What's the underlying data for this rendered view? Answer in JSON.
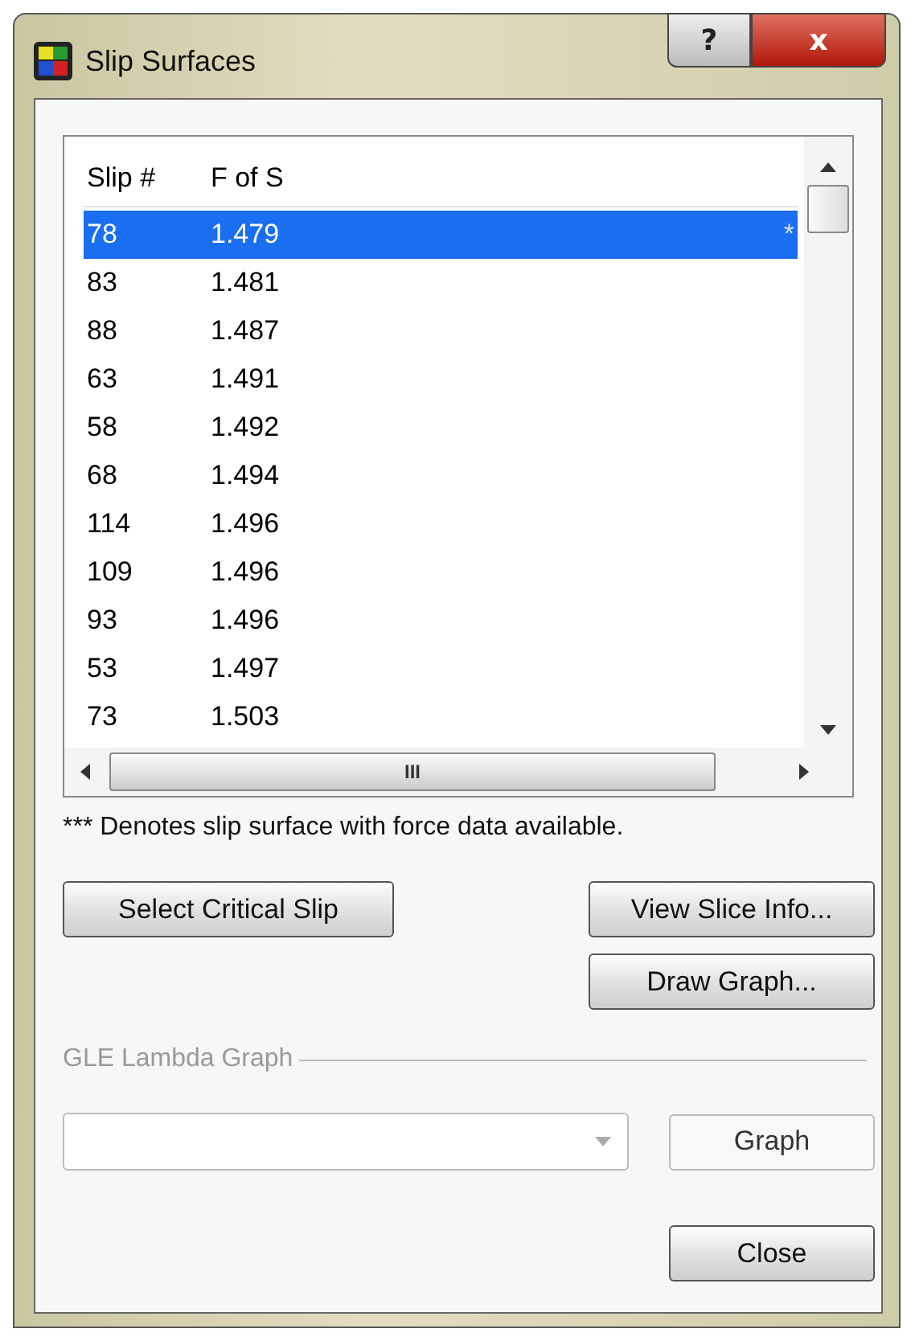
{
  "window": {
    "title": "Slip Surfaces",
    "help": "?",
    "close": "x"
  },
  "list": {
    "columns": [
      "Slip #",
      "F of S"
    ],
    "rows": [
      {
        "slip": "78",
        "fos": "1.479",
        "flag": "*",
        "selected": true
      },
      {
        "slip": "83",
        "fos": "1.481",
        "selected": false
      },
      {
        "slip": "88",
        "fos": "1.487",
        "selected": false
      },
      {
        "slip": "63",
        "fos": "1.491",
        "selected": false
      },
      {
        "slip": "58",
        "fos": "1.492",
        "selected": false
      },
      {
        "slip": "68",
        "fos": "1.494",
        "selected": false
      },
      {
        "slip": "114",
        "fos": "1.496",
        "selected": false
      },
      {
        "slip": "109",
        "fos": "1.496",
        "selected": false
      },
      {
        "slip": "93",
        "fos": "1.496",
        "selected": false
      },
      {
        "slip": "53",
        "fos": "1.497",
        "selected": false
      },
      {
        "slip": "73",
        "fos": "1.503",
        "selected": false
      }
    ],
    "hscroll_grip": "III"
  },
  "note": "*** Denotes slip surface with force data available.",
  "buttons": {
    "select_critical": "Select Critical Slip",
    "view_slice": "View Slice Info...",
    "draw_graph": "Draw Graph..."
  },
  "gle_group": {
    "label": "GLE Lambda Graph",
    "disabled": true,
    "graph_button": "Graph"
  },
  "close_button": "Close"
}
